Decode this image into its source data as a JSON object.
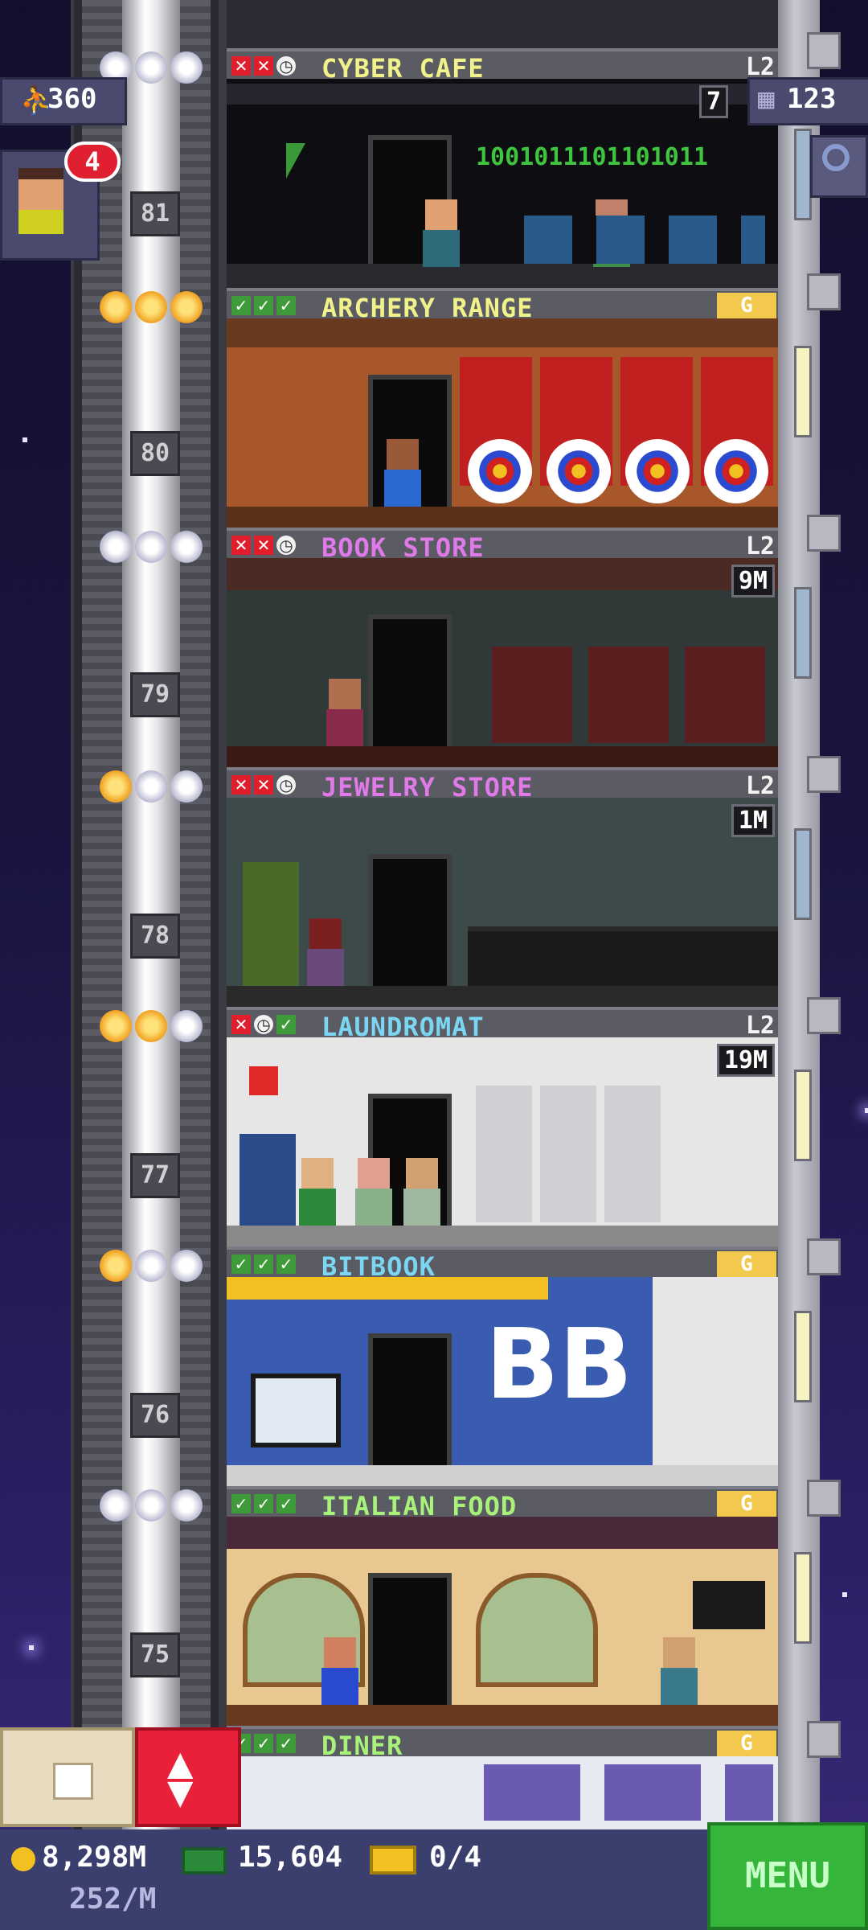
{
  "hud": {
    "population": "360",
    "population_icon": "person-icon",
    "floors_count": "123",
    "floors_icon": "building-icon",
    "search_icon": "magnifier-icon",
    "notification_count": "4",
    "coins": "8,298M",
    "income": "252/M",
    "bux": "15,604",
    "tickets": "0/4",
    "menu_label": "MENU"
  },
  "floors": [
    {
      "number": "81",
      "name": "CYBER CAFE",
      "name_color": "#f2f28a",
      "status": [
        "x",
        "x",
        "k"
      ],
      "stars": [
        "silver",
        "silver",
        "silver"
      ],
      "level": "L2",
      "timer": "7",
      "extra_text": "1001011101101011"
    },
    {
      "number": "80",
      "name": "ARCHERY RANGE",
      "name_color": "#f2f28a",
      "status": [
        "c",
        "c",
        "c"
      ],
      "stars": [
        "gold",
        "gold",
        "gold"
      ],
      "badge": "G"
    },
    {
      "number": "79",
      "name": "BOOK STORE",
      "name_color": "#e07ae8",
      "status": [
        "x",
        "x",
        "k"
      ],
      "stars": [
        "silver",
        "silver",
        "silver"
      ],
      "level": "L2",
      "timer": "9M"
    },
    {
      "number": "78",
      "name": "JEWELRY STORE",
      "name_color": "#e07ae8",
      "status": [
        "x",
        "x",
        "k"
      ],
      "stars": [
        "gold",
        "silver",
        "silver"
      ],
      "level": "L2",
      "timer": "1M"
    },
    {
      "number": "77",
      "name": "LAUNDROMAT",
      "name_color": "#7ad6f2",
      "status": [
        "x",
        "k",
        "c"
      ],
      "stars": [
        "gold",
        "gold",
        "silver"
      ],
      "level": "L2",
      "timer": "19M"
    },
    {
      "number": "76",
      "name": "BITBOOK",
      "name_color": "#7ad6f2",
      "status": [
        "c",
        "c",
        "c"
      ],
      "stars": [
        "gold",
        "silver",
        "silver"
      ],
      "badge": "G",
      "extra_text": "BB"
    },
    {
      "number": "75",
      "name": "ITALIAN FOOD",
      "name_color": "#a8f27a",
      "status": [
        "c",
        "c",
        "c"
      ],
      "stars": [
        "silver",
        "silver",
        "silver"
      ],
      "badge": "G"
    },
    {
      "number": "",
      "name": "DINER",
      "name_color": "#a8f27a",
      "status": [
        "c",
        "c",
        "c"
      ],
      "badge": "G"
    }
  ]
}
